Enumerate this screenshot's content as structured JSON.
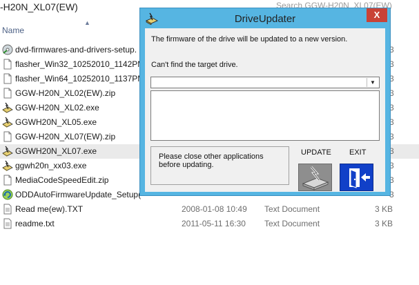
{
  "explorer": {
    "path": "-H20N_XL07(EW)",
    "search": "Search GGW-H20N_XL07(EW)",
    "column_name": "Name",
    "files": [
      {
        "name": "dvd-firmwares-and-drivers-setup.",
        "icon": "setup-disc-icon",
        "date": "",
        "type": "",
        "size": "3"
      },
      {
        "name": "flasher_Win32_10252010_1142PM.z",
        "icon": "document-icon",
        "date": "",
        "type": "",
        "size": "3"
      },
      {
        "name": "flasher_Win64_10252010_1137PM.z",
        "icon": "document-icon",
        "date": "",
        "type": "",
        "size": "3"
      },
      {
        "name": "GGW-H20N_XL02(EW).zip",
        "icon": "document-icon",
        "date": "",
        "type": "",
        "size": "3"
      },
      {
        "name": "GGW-H20N_XL02.exe",
        "icon": "drive-updater-icon",
        "date": "",
        "type": "",
        "size": "3"
      },
      {
        "name": "GGWH20N_XL05.exe",
        "icon": "drive-updater-icon",
        "date": "",
        "type": "",
        "size": "3"
      },
      {
        "name": "GGW-H20N_XL07(EW).zip",
        "icon": "document-icon",
        "date": "",
        "type": "",
        "size": "3"
      },
      {
        "name": "GGWH20N_XL07.exe",
        "icon": "drive-updater-icon",
        "date": "",
        "type": "",
        "size": "3"
      },
      {
        "name": "ggwh20n_xx03.exe",
        "icon": "drive-updater-icon",
        "date": "",
        "type": "",
        "size": "3"
      },
      {
        "name": "MediaCodeSpeedEdit.zip",
        "icon": "document-icon",
        "date": "",
        "type": "",
        "size": "3"
      },
      {
        "name": "ODDAutoFirmwareUpdate_Setup(",
        "icon": "auto-update-icon",
        "date": "",
        "type": "",
        "size": "3"
      },
      {
        "name": "Read me(ew).TXT",
        "icon": "text-file-icon",
        "date": "2008-01-08 10:49",
        "type": "Text Document",
        "size": "3 KB"
      },
      {
        "name": "readme.txt",
        "icon": "text-file-icon",
        "date": "2011-05-11 16:30",
        "type": "Text Document",
        "size": "3 KB"
      }
    ]
  },
  "dialog": {
    "title": "DriveUpdater",
    "close": "X",
    "message": "The firmware of the drive will be updated to a new version.",
    "status": "Can't find the target drive.",
    "note": "Please close other applications\nbefore updating.",
    "update_label": "UPDATE",
    "exit_label": "EXIT",
    "combo_arrow": "▼"
  },
  "colors": {
    "dialog_frame": "#56b5e2",
    "close_button": "#c94236",
    "exit_button": "#1140c8",
    "update_button": "#8e8e8e"
  }
}
